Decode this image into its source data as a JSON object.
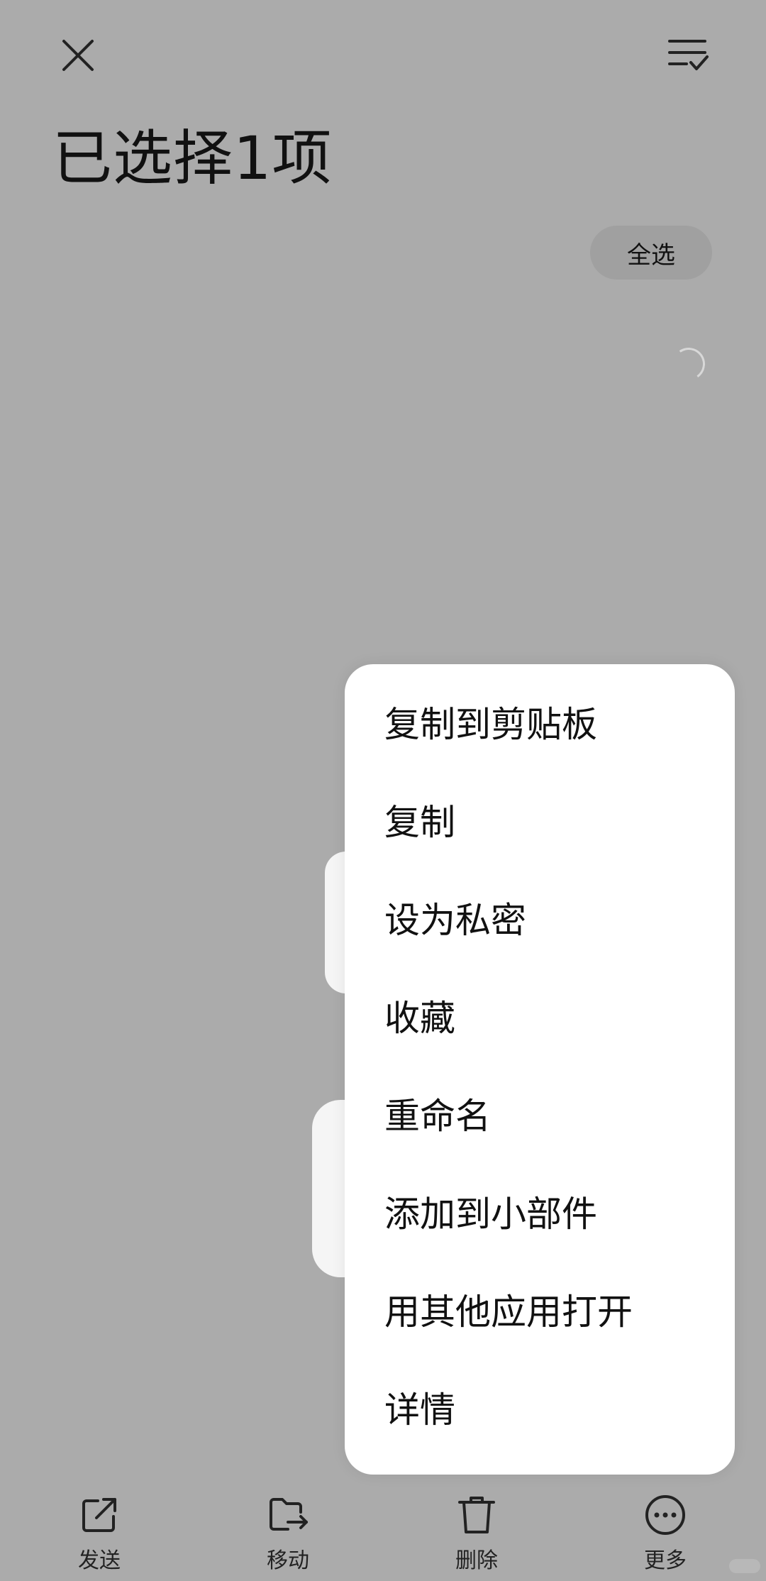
{
  "header": {
    "title": "已选择1项",
    "select_all_label": "全选",
    "close_icon": "close-icon",
    "sort_icon": "list-check-icon"
  },
  "menu": {
    "items": [
      {
        "label": "复制到剪贴板"
      },
      {
        "label": "复制"
      },
      {
        "label": "设为私密"
      },
      {
        "label": "收藏"
      },
      {
        "label": "重命名"
      },
      {
        "label": "添加到小部件"
      },
      {
        "label": "用其他应用打开"
      },
      {
        "label": "详情"
      }
    ]
  },
  "toolbar": {
    "send_label": "发送",
    "move_label": "移动",
    "delete_label": "删除",
    "more_label": "更多"
  },
  "colors": {
    "overlay": "#ababab",
    "menu_bg": "#ffffff",
    "text": "#111111"
  }
}
